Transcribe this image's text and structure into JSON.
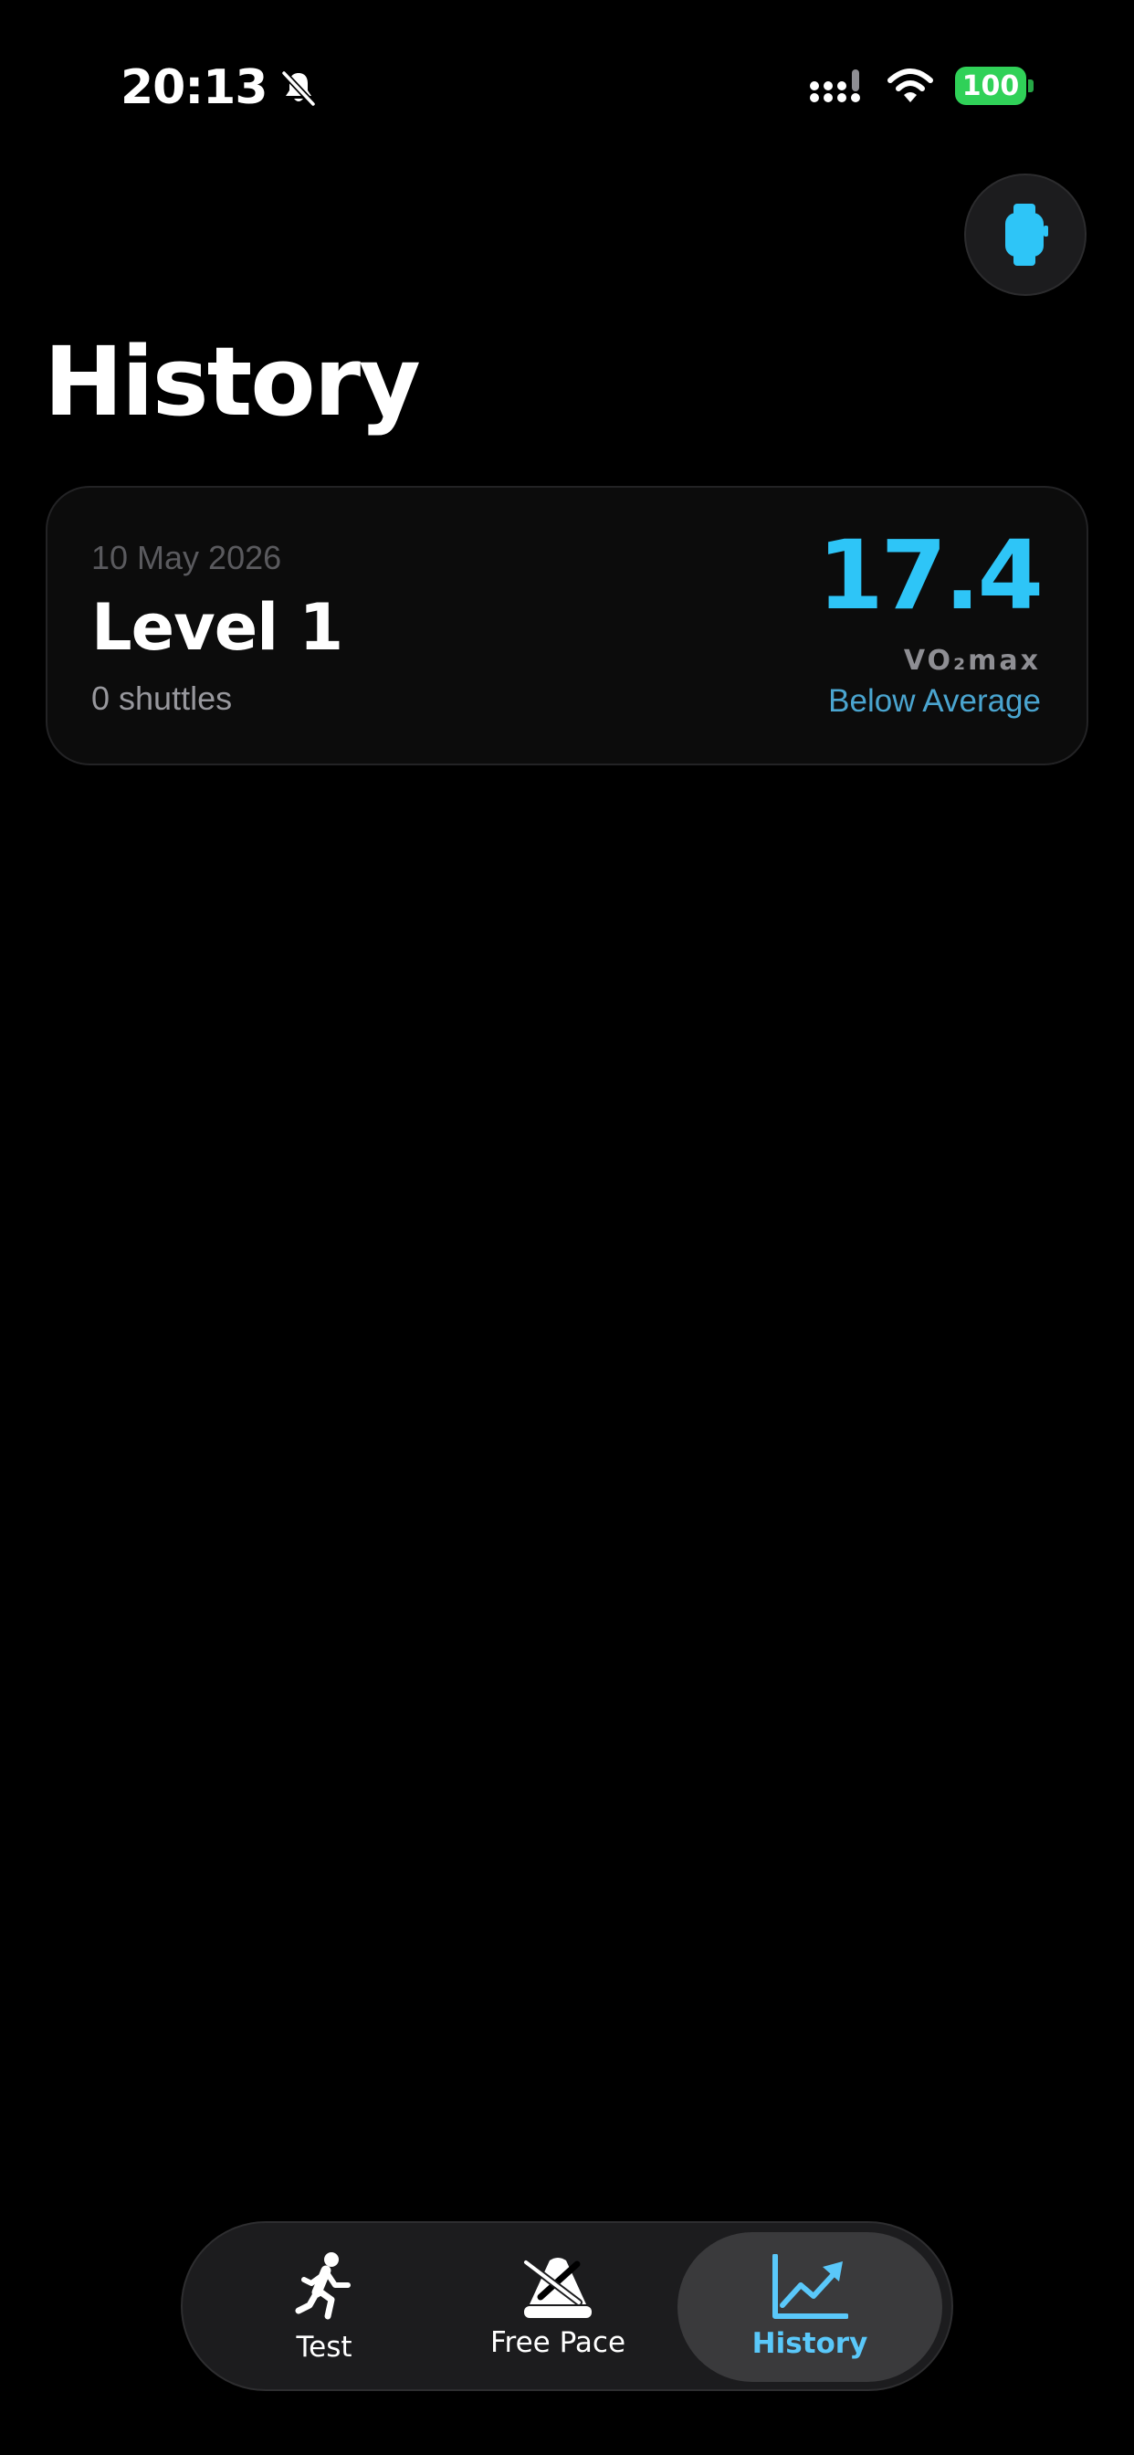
{
  "status_bar": {
    "time": "20:13",
    "battery": "100",
    "icons": [
      "bell-slash-icon",
      "cellular-signal-icon",
      "wifi-icon",
      "battery-icon"
    ],
    "battery_color": "#30d158"
  },
  "header": {
    "watch_icon": "applewatch-icon",
    "title": "History"
  },
  "history": {
    "entries": [
      {
        "date": "10 May 2026",
        "level": "Level 1",
        "shuttles": "0 shuttles",
        "vo2max_value": "17.4",
        "vo2max_label": "VO₂max",
        "rating": "Below Average"
      }
    ]
  },
  "tab_bar": {
    "tabs": [
      {
        "label": "Test",
        "icon": "figure-run-icon",
        "selected": false
      },
      {
        "label": "Free Pace",
        "icon": "metronome-icon",
        "selected": false
      },
      {
        "label": "History",
        "icon": "chart-line-uptrend-icon",
        "selected": true
      }
    ]
  },
  "colors": {
    "accent": "#2ec5f7",
    "tab_selected": "#5ac8fa",
    "rating": "#4aa5d0",
    "background": "#000000"
  }
}
